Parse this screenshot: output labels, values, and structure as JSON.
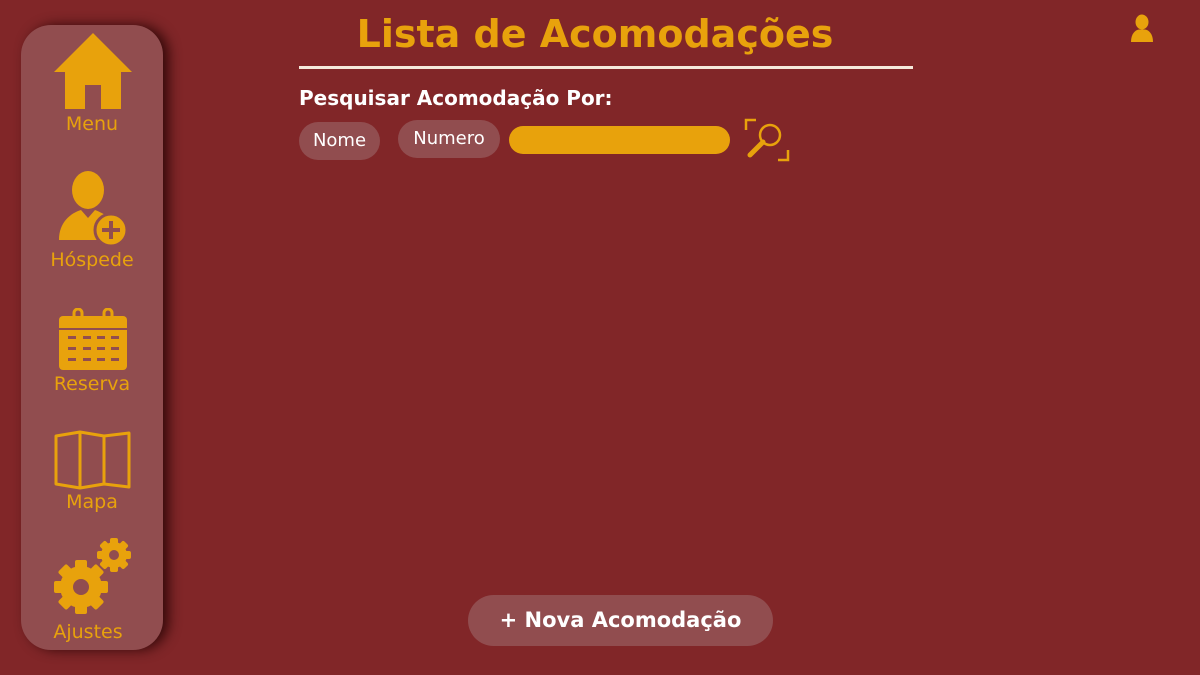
{
  "sidebar": {
    "items": [
      {
        "label": "Menu",
        "icon": "home-icon"
      },
      {
        "label": "Hóspede",
        "icon": "add-user-icon"
      },
      {
        "label": "Reserva",
        "icon": "calendar-icon"
      },
      {
        "label": "Mapa",
        "icon": "map-icon"
      },
      {
        "label": "Ajustes",
        "icon": "gears-icon"
      }
    ]
  },
  "header": {
    "title": "Lista de Acomodações",
    "user_icon": "user-icon"
  },
  "search": {
    "label": "Pesquisar Acomodação Por:",
    "filters": [
      "Nome",
      "Numero"
    ],
    "input_value": "",
    "button_icon": "search-icon"
  },
  "actions": {
    "new_label": "+ Nova Acomodação"
  },
  "colors": {
    "background": "#812628",
    "panel": "#914d4f",
    "accent": "#e8a20c",
    "text": "#ffffff",
    "rule": "#f5e9dc"
  }
}
